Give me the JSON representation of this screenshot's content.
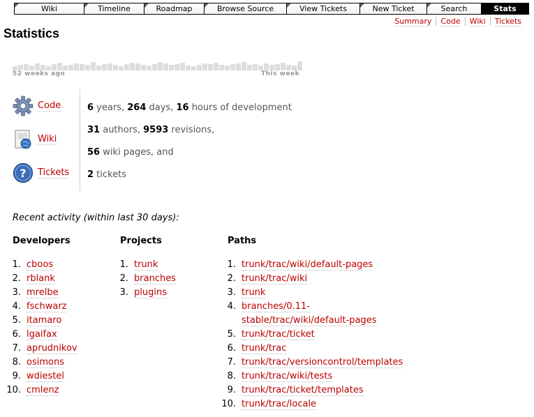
{
  "nav": {
    "items": [
      "Wiki",
      "Timeline",
      "Roadmap",
      "Browse Source",
      "View Tickets",
      "New Ticket",
      "Search",
      "Stats"
    ],
    "active": "Stats"
  },
  "ctxtnav": [
    "Summary",
    "Code",
    "Wiki",
    "Tickets"
  ],
  "page_title": "Statistics",
  "activity_chart": {
    "left_label": "52 weeks ago",
    "right_label": "This week"
  },
  "categories": [
    {
      "label": "Code",
      "icon": "gear-icon"
    },
    {
      "label": "Wiki",
      "icon": "wiki-page-icon"
    },
    {
      "label": "Tickets",
      "icon": "question-icon"
    }
  ],
  "summary": {
    "line1": {
      "a": "6",
      "b": " years, ",
      "c": "264",
      "d": " days, ",
      "e": "16",
      "f": " hours of development"
    },
    "line2": {
      "a": "31",
      "b": " authors, ",
      "c": "9593",
      "d": " revisions,"
    },
    "line3": {
      "a": "56",
      "b": " wiki pages, and"
    },
    "line4": {
      "a": "2",
      "b": " tickets"
    }
  },
  "recent_heading": "Recent activity (within last 30 days):",
  "developers": {
    "heading": "Developers",
    "items": [
      "cboos",
      "rblank",
      "mrelbe",
      "fschwarz",
      "itamaro",
      "lgaifax",
      "aprudnikov",
      "osimons",
      "wdiestel",
      "cmlenz"
    ]
  },
  "projects": {
    "heading": "Projects",
    "items": [
      "trunk",
      "branches",
      "plugins"
    ]
  },
  "paths": {
    "heading": "Paths",
    "items": [
      "trunk/trac/wiki/default-pages",
      "trunk/trac/wiki",
      "trunk",
      "branches/0.11-\nstable/trac/wiki/default-pages",
      "trunk/trac/ticket",
      "trunk/trac",
      "trunk/trac/versioncontrol/templates",
      "trunk/trac/wiki/tests",
      "trunk/trac/ticket/templates",
      "trunk/trac/locale"
    ]
  }
}
